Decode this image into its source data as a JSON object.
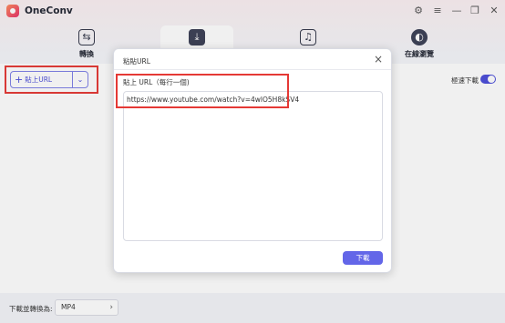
{
  "app": {
    "title": "OneConv"
  },
  "window_controls": {
    "settings_icon": "gear-icon",
    "menu_icon": "hamburger-icon",
    "minimize_icon": "minimize-icon",
    "maximize_icon": "maximize-icon",
    "close_icon": "close-icon"
  },
  "nav": {
    "tabs": [
      {
        "label": "轉換",
        "icon": "convert-icon"
      },
      {
        "label": "",
        "icon": "download-icon",
        "active": true
      },
      {
        "label": "",
        "icon": "music-note-icon"
      },
      {
        "label": "在線瀏覽",
        "icon": "browser-icon"
      }
    ]
  },
  "main": {
    "paste_url_label": "貼上URL",
    "speed_download_label": "極速下載",
    "speed_download_on": true
  },
  "bottom": {
    "convert_label": "下載並轉換為:",
    "format_value": "MP4"
  },
  "dialog": {
    "title": "粘貼URL",
    "instruction": "貼上 URL（每行一個)",
    "url_value": "https://www.youtube.com/watch?v=4wlO5H8kSV4",
    "download_label": "下載"
  },
  "colors": {
    "accent": "#6366e8",
    "highlight": "#e53935"
  }
}
